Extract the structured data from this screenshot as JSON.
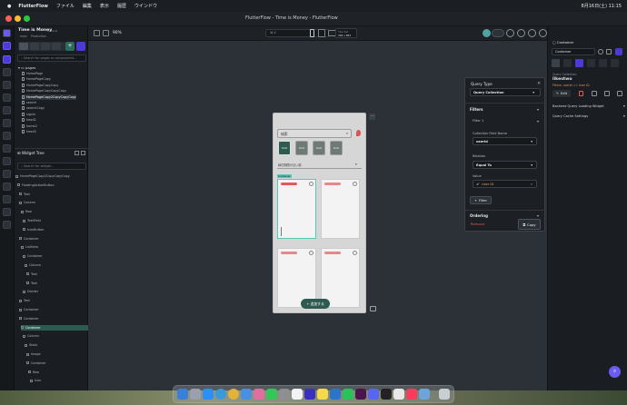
{
  "menubar": {
    "apple": "",
    "app_name": "FlutterFlow",
    "items": [
      "ファイル",
      "編集",
      "表示",
      "履歴",
      "ウインドウ"
    ],
    "clock": "8月16日(土) 11:15"
  },
  "window": {
    "title": "FlutterFlow - Time is Money - FlutterFlow"
  },
  "project": {
    "name": "Time is Money",
    "badge": "Default",
    "branch": "main",
    "env": "Production"
  },
  "toolbar": {
    "zoom": "90%",
    "device_label": "Size Set",
    "device_size": "393 x 852",
    "search_hint": "⌘ K"
  },
  "left_panel": {
    "search_placeholder": "Search for pages or components...",
    "pages_header": "pages",
    "pages": [
      "HomePage",
      "HomePageCopy",
      "HomePageCopyCopy",
      "HomePageCopyCopyCopy",
      "HomePageCopy2CopyCopyCopy",
      "search",
      "searchCopy",
      "signin",
      "head2",
      "home2",
      "head3"
    ],
    "widget_tree_title": "Widget Tree",
    "widget_search_placeholder": "Search for widget...",
    "tree": [
      "HomePageCopy2CopyCopyCopy",
      "FloatingActionButton",
      "Text",
      "Column",
      "Row",
      "TextField",
      "IconButton",
      "Container",
      "ListView",
      "Container",
      "Column",
      "Text",
      "Text",
      "Divider",
      "Text",
      "Container",
      "Container",
      "Container",
      "Column",
      "Stack",
      "Image",
      "Container",
      "Row",
      "Icon"
    ]
  },
  "phone": {
    "search_placeholder": "検索",
    "chips": [
      "DAR",
      "DAR",
      "DAR",
      "DAR"
    ],
    "sort_label": "締切期限が近い順",
    "selected_label": "Container",
    "fab_label": "+ 追加する"
  },
  "query_panel": {
    "title": "Query Type",
    "type_value": "Query Collection",
    "filters_header": "Filters",
    "filter_1": "Filter 1",
    "collection_field_label": "Collection Field Name",
    "collection_field_value": "userId",
    "relation_label": "Relation",
    "relation_value": "Equal To",
    "value_label": "Value",
    "value_value": "User ID",
    "add_filter": "Filter",
    "ordering": "Ordering",
    "remove": "Remove",
    "copy": "Copy"
  },
  "right_panel": {
    "widget_type": "Container",
    "widget_name": "Container",
    "query_collection_label": "Query Collection",
    "collection_name": "likestwo",
    "filter_summary": "Filters: userId == User ID",
    "edit": "Edit",
    "backend_loading": "Backend Query Loading Widget",
    "query_cache": "Query Cache Settings"
  },
  "colors": {
    "accent": "#6a5cf0",
    "selection": "#58c7b7",
    "danger": "#e05a5a",
    "primary_green": "#2f5a50"
  }
}
